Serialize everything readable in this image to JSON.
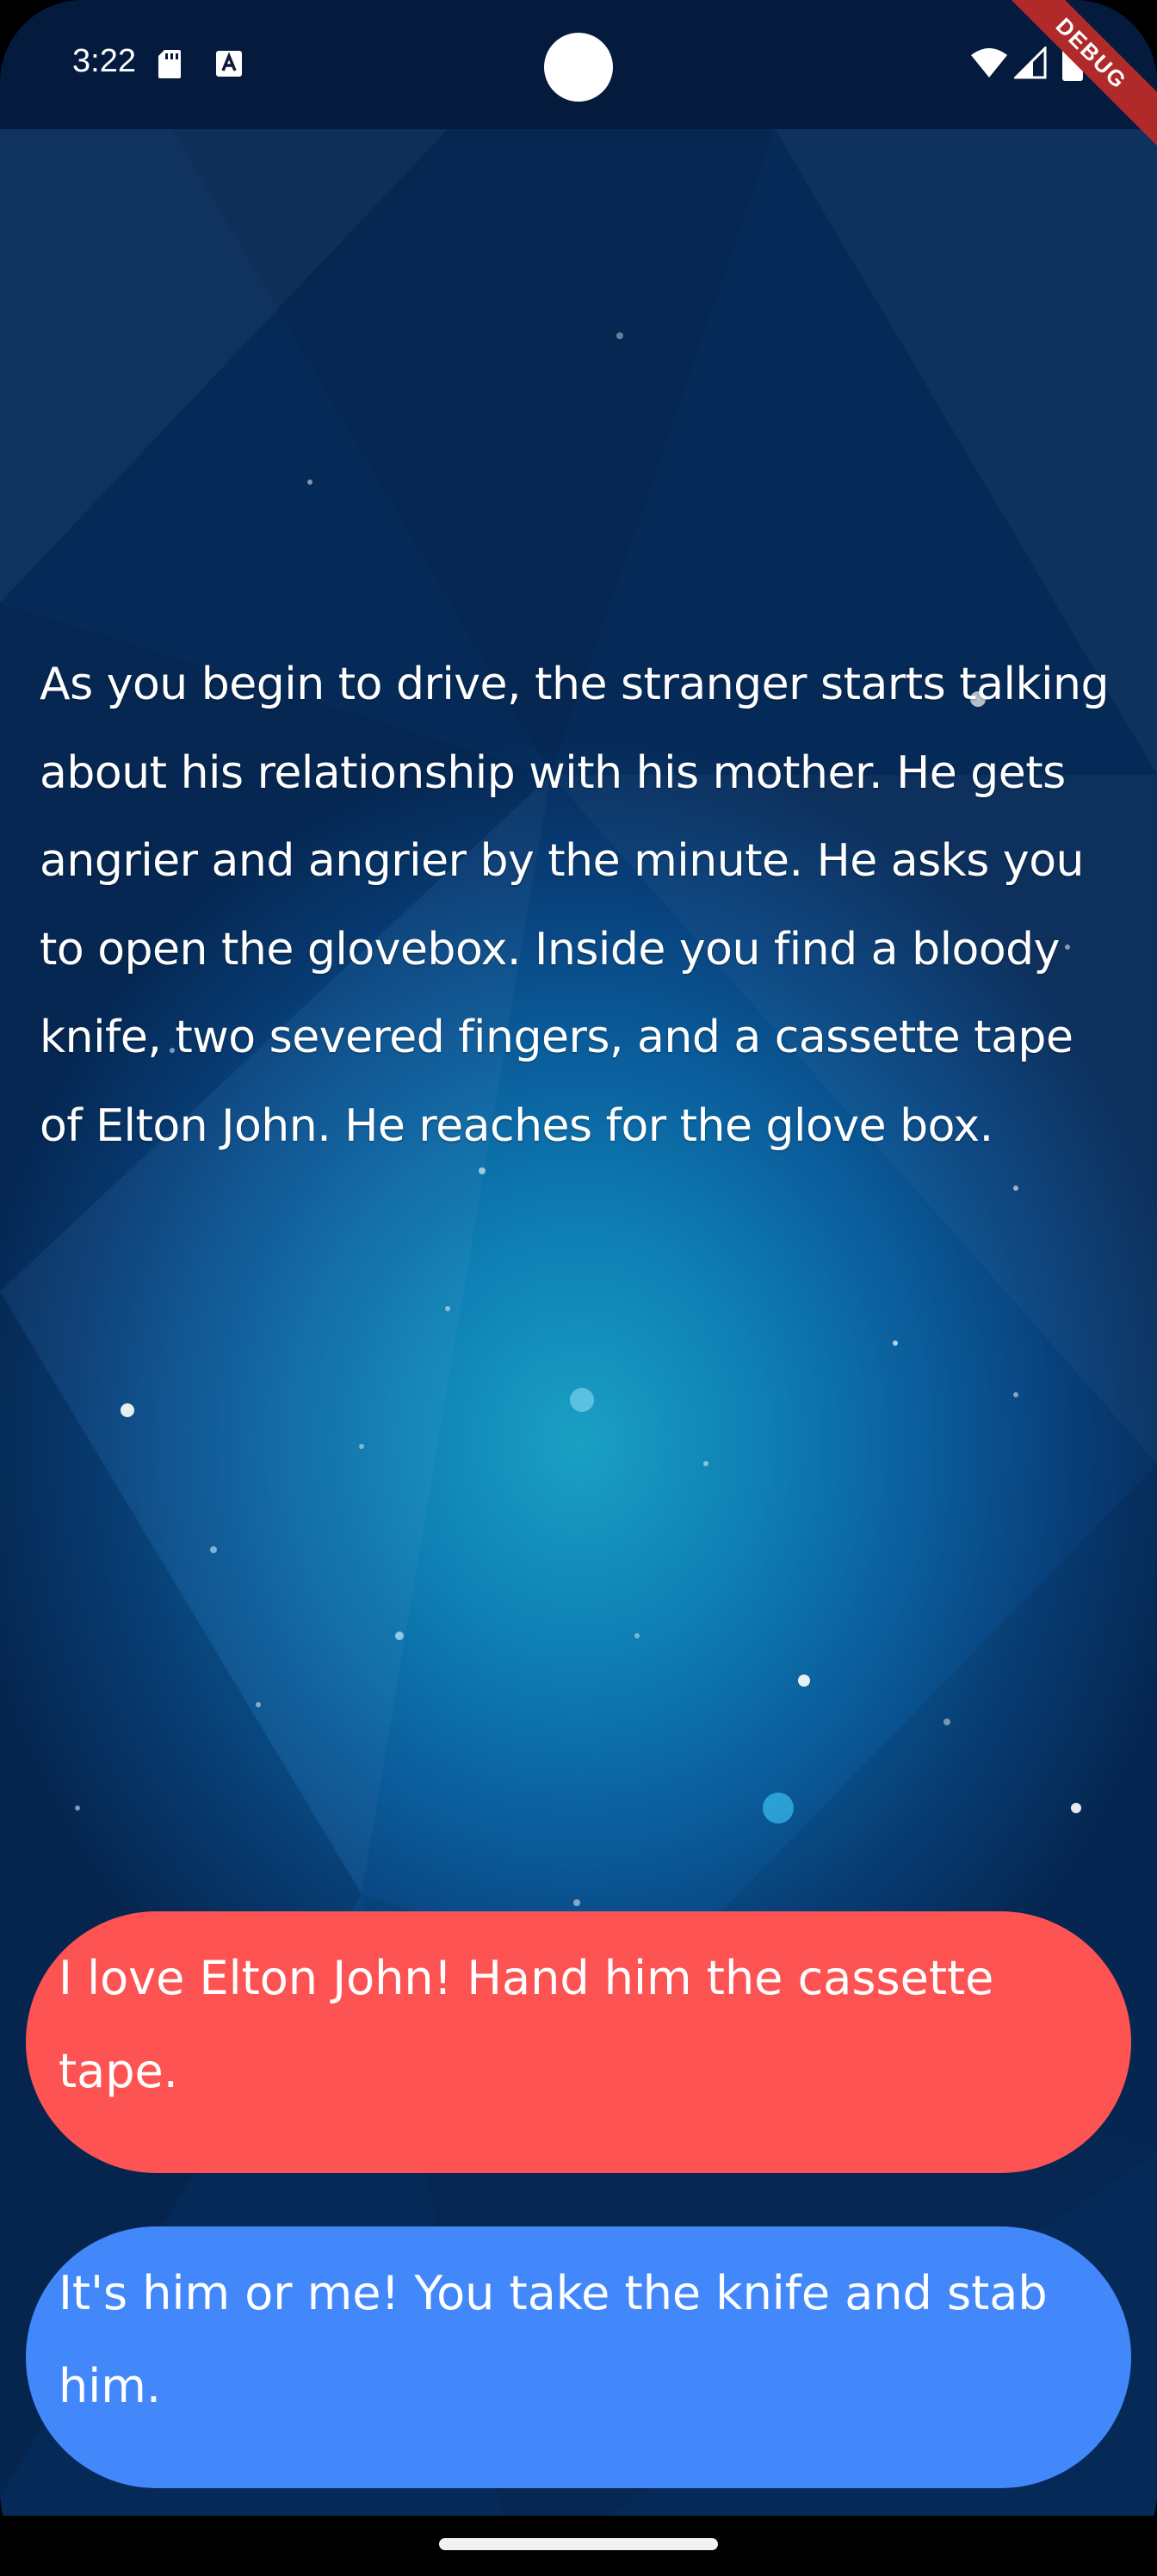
{
  "status_bar": {
    "time": "3:22",
    "icons": [
      "sd-card-icon",
      "a-notification-icon",
      "wifi-icon",
      "signal-icon",
      "battery-icon"
    ]
  },
  "debug_banner": "DEBUG",
  "story": {
    "text": "As you begin to drive, the stranger starts talking about his relationship with his mother. He gets angrier and angrier by the minute. He asks you to open the glovebox. Inside you find a bloody knife, two severed fingers, and a cassette tape of Elton John. He reaches for the glove box."
  },
  "choices": [
    {
      "label": "I love Elton John! Hand him the cassette tape.",
      "color": "#fd5353"
    },
    {
      "label": "It's him or me! You take the knife and stab him.",
      "color": "#4388fb"
    }
  ],
  "colors": {
    "background_center": "#1aa0c4",
    "background_edge": "#062a58",
    "text": "#ffffff",
    "debug_banner": "#b12a2a"
  }
}
